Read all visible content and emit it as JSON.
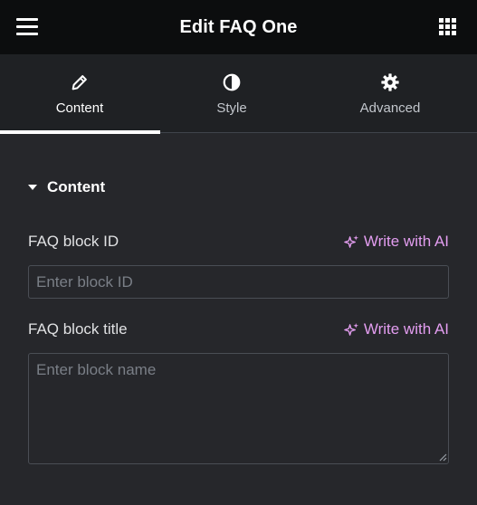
{
  "header": {
    "title": "Edit FAQ One",
    "menu_icon": "hamburger-menu-icon",
    "apps_icon": "grid-apps-icon"
  },
  "tabs": [
    {
      "label": "Content",
      "icon": "pencil-icon",
      "active": true
    },
    {
      "label": "Style",
      "icon": "half-circle-contrast-icon",
      "active": false
    },
    {
      "label": "Advanced",
      "icon": "gear-icon",
      "active": false
    }
  ],
  "section": {
    "title": "Content",
    "expanded": true
  },
  "fields": {
    "block_id": {
      "label": "FAQ block ID",
      "ai_label": "Write with AI",
      "value": "",
      "placeholder": "Enter block ID"
    },
    "block_title": {
      "label": "FAQ block title",
      "ai_label": "Write with AI",
      "value": "",
      "placeholder": "Enter block name"
    }
  },
  "colors": {
    "header_bg": "#0c0d0e",
    "panel_bg": "#26272b",
    "tabs_bg": "#1f2124",
    "ai_accent": "#e39df0",
    "active_tab_indicator": "#ffffff"
  }
}
